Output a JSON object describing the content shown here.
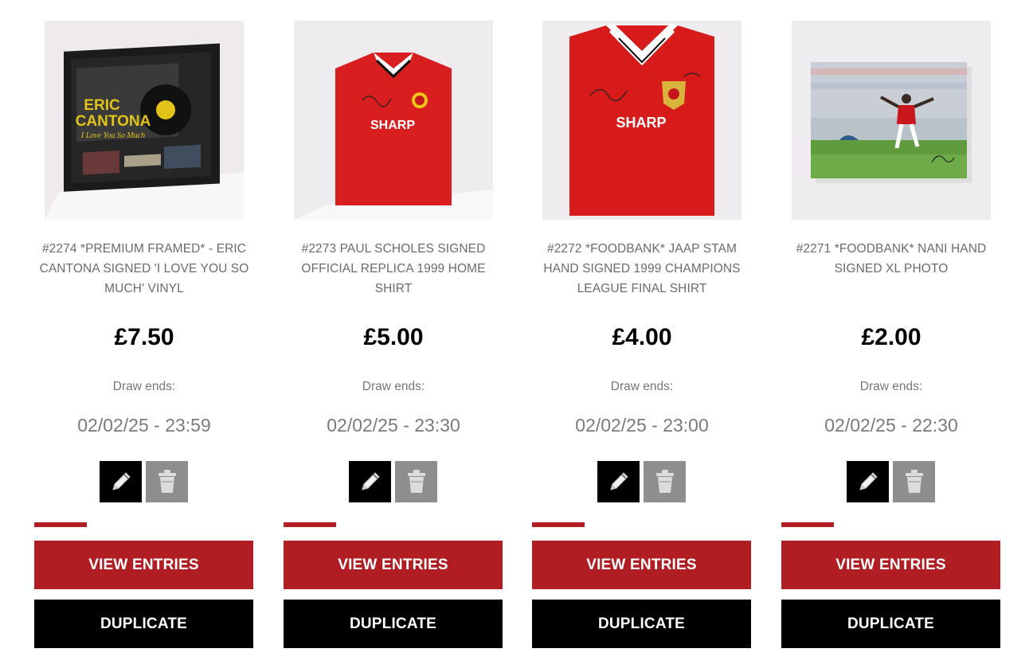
{
  "draw_label": "Draw ends:",
  "buttons": {
    "view_entries": "VIEW ENTRIES",
    "duplicate": "DUPLICATE"
  },
  "colors": {
    "brand_red": "#b01e24",
    "black": "#000000",
    "delete_gray": "#8e8e8e"
  },
  "icons": {
    "edit": "pencil-icon",
    "delete": "trash-icon"
  },
  "competitions": [
    {
      "title": "#2274 *PREMIUM FRAMED* - ERIC CANTONA SIGNED 'I LOVE YOU SO MUCH' VINYL",
      "price": "£7.50",
      "draw_date": "02/02/25 - 23:59",
      "image_text": {
        "line1": "ERIC",
        "line2": "CANTONA",
        "line3": "I Love You So Much"
      }
    },
    {
      "title": "#2273 PAUL SCHOLES SIGNED OFFICIAL REPLICA 1999 HOME SHIRT",
      "price": "£5.00",
      "draw_date": "02/02/25 - 23:30",
      "image_text": {
        "sponsor": "SHARP"
      }
    },
    {
      "title": "#2272 *FOODBANK* JAAP STAM HAND SIGNED 1999 CHAMPIONS LEAGUE FINAL SHIRT",
      "price": "£4.00",
      "draw_date": "02/02/25 - 23:00",
      "image_text": {
        "sponsor": "SHARP"
      }
    },
    {
      "title": "#2271 *FOODBANK* NANI HAND SIGNED XL PHOTO",
      "price": "£2.00",
      "draw_date": "02/02/25 - 22:30",
      "image_text": {}
    }
  ]
}
